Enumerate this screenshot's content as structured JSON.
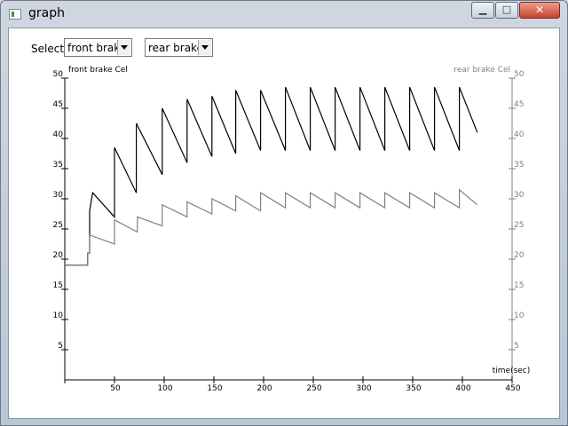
{
  "window": {
    "title": "graph",
    "min_glyph": "▁",
    "max_glyph": "□",
    "close_glyph": "✕"
  },
  "toolbar": {
    "select_label": "Select",
    "front_select_value": "front brake",
    "rear_select_value": "rear brake C"
  },
  "colors": {
    "front": "#000000",
    "rear": "#808080",
    "axis": "#000000",
    "right_axis": "#808080"
  },
  "chart_data": {
    "type": "line",
    "xlabel": "time(sec)",
    "ylabel_left": "front brake Cel",
    "ylabel_right": "rear brake Cel",
    "xlim": [
      0,
      450
    ],
    "ylim": [
      0,
      50
    ],
    "x_ticks": [
      50,
      100,
      150,
      200,
      250,
      300,
      350,
      400,
      450
    ],
    "y_ticks": [
      5,
      10,
      15,
      20,
      25,
      30,
      35,
      40,
      45,
      50
    ],
    "grid": false,
    "series": [
      {
        "name": "front brake Cel",
        "axis": "left",
        "x": [
          0,
          23,
          23,
          25,
          25,
          28,
          50,
          50,
          72,
          72,
          98,
          98,
          123,
          123,
          148,
          148,
          172,
          172,
          197,
          197,
          222,
          222,
          247,
          247,
          272,
          272,
          297,
          297,
          322,
          322,
          347,
          347,
          372,
          372,
          397,
          397,
          415
        ],
        "y": [
          19,
          19,
          21,
          21,
          28,
          31,
          27,
          38.5,
          31,
          42.5,
          34,
          45,
          36,
          46.5,
          37,
          47,
          37.5,
          48,
          38,
          48,
          38,
          48.5,
          38,
          48.5,
          38,
          48.5,
          38,
          48.5,
          38,
          48.5,
          38,
          48.5,
          38,
          48.5,
          38,
          48.5,
          41
        ]
      },
      {
        "name": "rear brake Cel",
        "axis": "right",
        "x": [
          0,
          23,
          23,
          25,
          25,
          50,
          50,
          73,
          73,
          98,
          98,
          123,
          123,
          148,
          148,
          172,
          172,
          197,
          197,
          222,
          222,
          247,
          247,
          272,
          272,
          297,
          297,
          322,
          322,
          347,
          347,
          372,
          372,
          397,
          397,
          415
        ],
        "y": [
          19,
          19,
          21,
          21,
          24,
          22.5,
          26.5,
          24.5,
          27,
          25.5,
          29,
          27,
          29.5,
          27.5,
          30,
          28,
          30.5,
          28,
          31,
          28.5,
          31,
          28.5,
          31,
          28.5,
          31,
          28.5,
          31,
          28.5,
          31,
          28.5,
          31,
          28.5,
          31,
          28.5,
          31.5,
          29
        ]
      }
    ]
  }
}
